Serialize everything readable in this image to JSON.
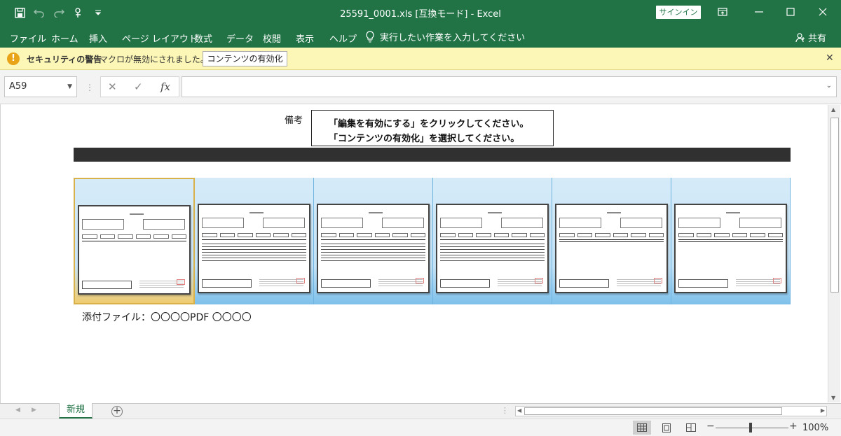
{
  "window": {
    "title": "25591_0001.xls  [互換モード]  -  Excel",
    "signin": "サインイン"
  },
  "ribbon": {
    "tabs": [
      "ファイル",
      "ホーム",
      "挿入",
      "ページ レイアウト",
      "数式",
      "データ",
      "校閲",
      "表示",
      "ヘルプ"
    ],
    "tell_me": "実行したい作業を入力してください",
    "share": "共有"
  },
  "security": {
    "title": "セキュリティの警告",
    "message": "マクロが無効にされました。",
    "enable_button": "コンテンツの有効化"
  },
  "formula_bar": {
    "name_box": "A59",
    "cancel": "✕",
    "enter": "✓",
    "fx": "fx",
    "value": ""
  },
  "sheet": {
    "biko_label": "備考",
    "note_line1": "「編集を有効にする」をクリックしてください。",
    "note_line2": "「コンテンツの有効化」を選択してください。",
    "attachment": "添付ファイル：〇〇〇〇PDF 〇〇〇〇",
    "thumbnail_count": 6
  },
  "sheet_tabs": {
    "active": "新規",
    "add": "+"
  },
  "status": {
    "zoom": "100%"
  },
  "colors": {
    "excel_green": "#217346",
    "security_bg": "#fcf7b6"
  }
}
